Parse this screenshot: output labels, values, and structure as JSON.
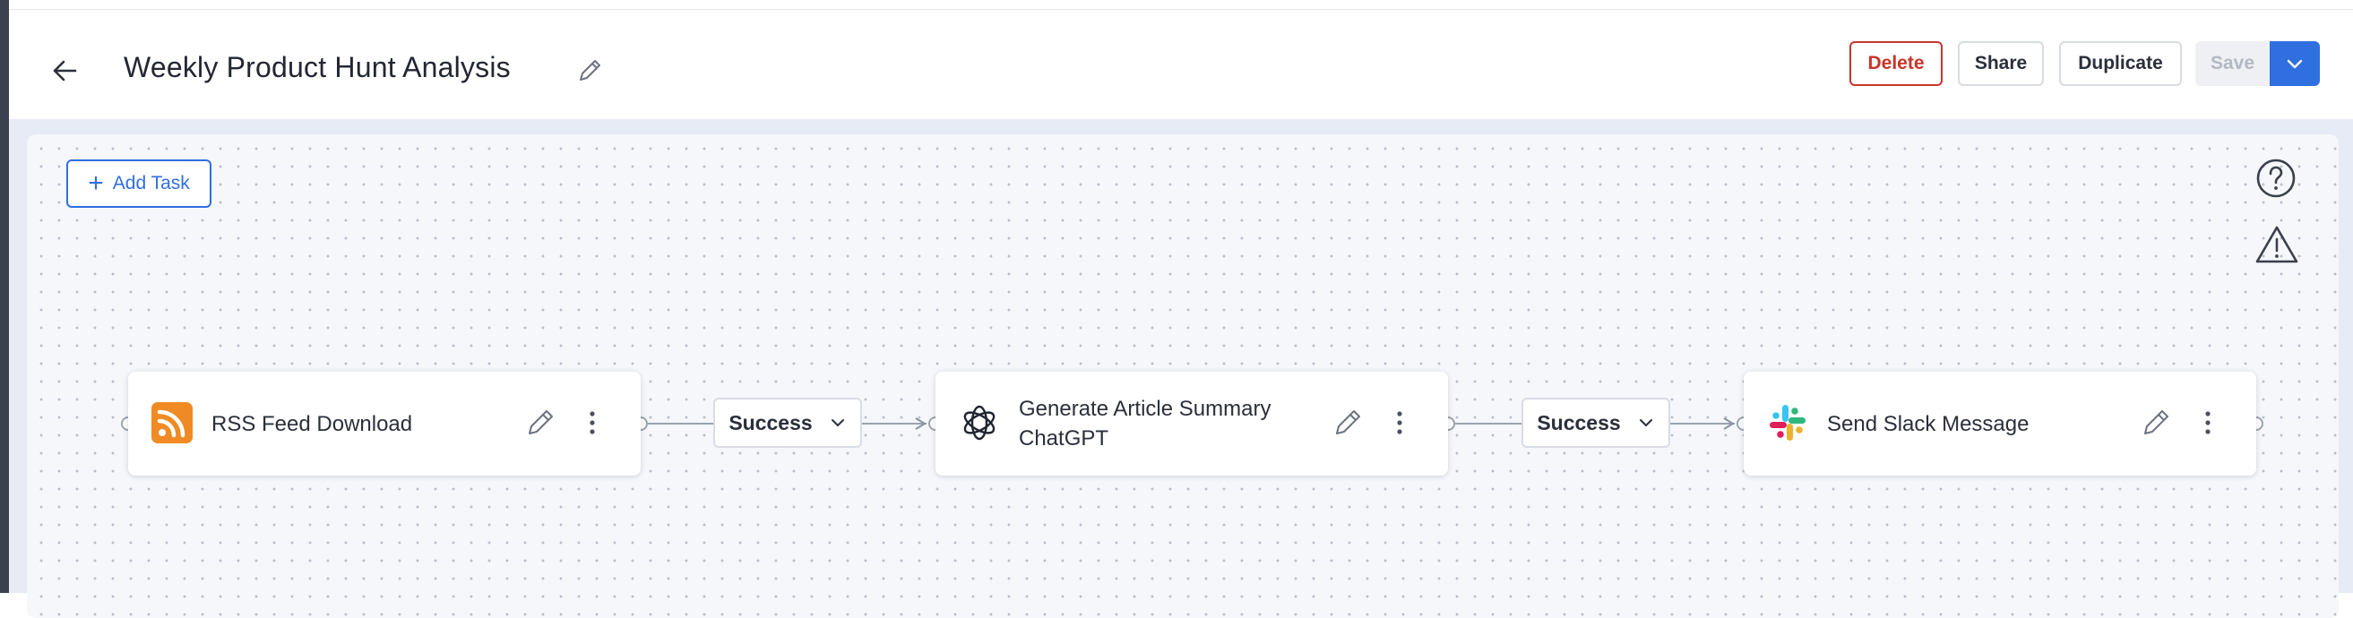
{
  "header": {
    "title": "Weekly Product Hunt Analysis",
    "buttons": {
      "delete": "Delete",
      "share": "Share",
      "duplicate": "Duplicate",
      "save": "Save"
    }
  },
  "toolbar": {
    "add_task": "Add Task"
  },
  "nodes": [
    {
      "label": "RSS Feed Download",
      "icon": "rss-icon"
    },
    {
      "label_line1": "Generate Article Summary",
      "label_line2": "ChatGPT",
      "icon": "openai-icon"
    },
    {
      "label": "Send Slack Message",
      "icon": "slack-icon"
    }
  ],
  "edges": [
    {
      "condition": "Success"
    },
    {
      "condition": "Success"
    }
  ],
  "colors": {
    "primary": "#2f6fe0",
    "danger": "#c7352a",
    "rss_orange": "#f08a24",
    "canvas": "#f5f7fb"
  }
}
